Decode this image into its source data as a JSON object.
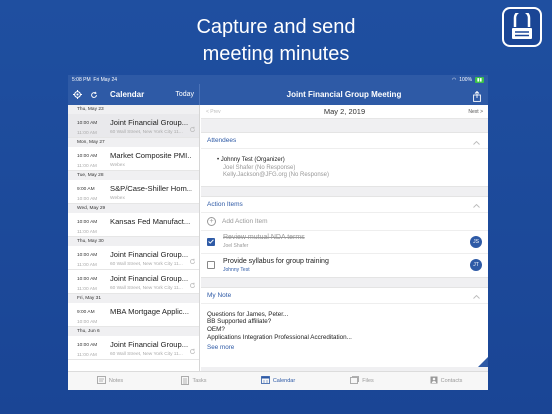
{
  "headline": {
    "line1": "Capture and send",
    "line2": "meeting minutes"
  },
  "statusbar": {
    "time": "5:08 PM",
    "date": "Fri May 24",
    "battery": "100%"
  },
  "sidebar": {
    "title": "Calendar",
    "today_label": "Today",
    "days": [
      {
        "label": "Thu, May 23",
        "events": [
          {
            "start": "10:00 AM",
            "end": "11:00 AM",
            "name": "Joint Financial Group...",
            "location": "60 Wall Street, New York City 11...",
            "selected": true,
            "sync": true
          }
        ]
      },
      {
        "label": "Mon, May 27",
        "events": [
          {
            "start": "10:00 AM",
            "end": "11:00 AM",
            "name": "Market Composite PMI...",
            "location": "Webex",
            "selected": false,
            "sync": false
          }
        ]
      },
      {
        "label": "Tue, May 28",
        "events": [
          {
            "start": "9:00 AM",
            "end": "10:00 AM",
            "name": "S&P/Case-Shiller Hom...",
            "location": "Webex",
            "selected": false,
            "sync": false
          }
        ]
      },
      {
        "label": "Wed, May 29",
        "events": [
          {
            "start": "10:00 AM",
            "end": "11:00 AM",
            "name": "Kansas Fed Manufact...",
            "location": "",
            "selected": false,
            "sync": false
          }
        ]
      },
      {
        "label": "Thu, May 30",
        "events": [
          {
            "start": "10:00 AM",
            "end": "11:00 AM",
            "name": "Joint Financial Group...",
            "location": "60 Wall Street, New York City 11...",
            "selected": false,
            "sync": true
          },
          {
            "start": "10:00 AM",
            "end": "11:00 AM",
            "name": "Joint Financial Group...",
            "location": "60 Wall Street, New York City 11...",
            "selected": false,
            "sync": true
          }
        ]
      },
      {
        "label": "Fri, May 31",
        "events": [
          {
            "start": "9:00 AM",
            "end": "10:00 AM",
            "name": "MBA Mortgage Applic...",
            "location": "",
            "selected": false,
            "sync": false
          }
        ]
      },
      {
        "label": "Thu, Jun 6",
        "events": [
          {
            "start": "10:00 AM",
            "end": "11:00 AM",
            "name": "Joint Financial Group...",
            "location": "60 Wall Street, New York City 11...",
            "selected": false,
            "sync": true
          }
        ]
      }
    ]
  },
  "detail": {
    "title": "Joint Financial Group Meeting",
    "prev_label": "< Prev",
    "next_label": "Next >",
    "date": "May 2, 2019",
    "attendees_label": "Attendees",
    "organizer": "Johnny Test (Organizer)",
    "other_attendees": [
      "Joel Shafer (No Response)",
      "Kelly.Jackson@JFG.org (No Response)"
    ],
    "action_items_label": "Action Items",
    "add_action_label": "Add Action Item",
    "action_items": [
      {
        "title": "Review mutual NDA terms",
        "owner": "Joel Shafer",
        "done": true,
        "initials": "JS"
      },
      {
        "title": "Provide syllabus for group training",
        "owner": "Johnny Test",
        "done": false,
        "initials": "JT"
      }
    ],
    "note_label": "My Note",
    "note_lines": [
      "Questions for James, Peter...",
      "BB Supported affiliate?",
      "OEM?",
      "Applications Integration Professional Accreditation..."
    ],
    "see_more": "See more"
  },
  "tabs": [
    {
      "label": "Notes",
      "icon": "notes-icon",
      "active": false
    },
    {
      "label": "Tasks",
      "icon": "tasks-icon",
      "active": false
    },
    {
      "label": "Calendar",
      "icon": "calendar-icon",
      "active": true
    },
    {
      "label": "Files",
      "icon": "files-icon",
      "active": false
    },
    {
      "label": "Contacts",
      "icon": "contacts-icon",
      "active": false
    }
  ],
  "colors": {
    "brand": "#2e5aa6",
    "background": "#1f4fa0"
  }
}
